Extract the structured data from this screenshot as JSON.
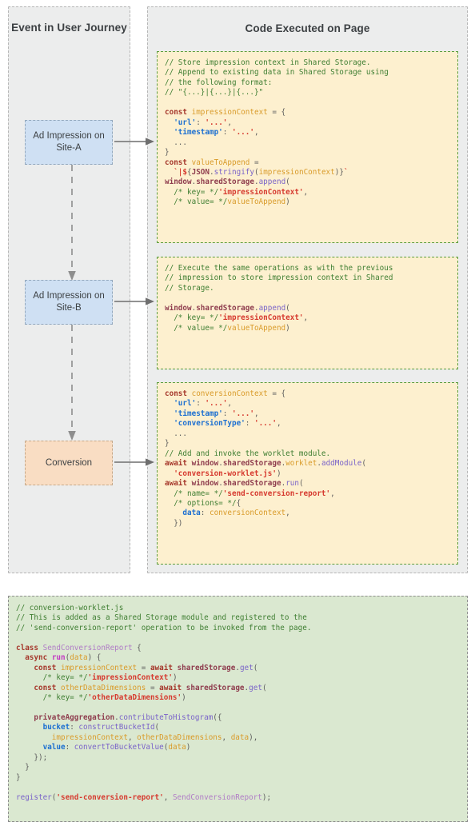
{
  "diagram": {
    "title_journey": "Event in User Journey",
    "title_code": "Code Executed on Page",
    "nodes": [
      {
        "id": "ad-impression-site-a",
        "label": "Ad Impression on Site-A",
        "color": "#cfe0f3"
      },
      {
        "id": "ad-impression-site-b",
        "label": "Ad Impression on Site-B",
        "color": "#cfe0f3"
      },
      {
        "id": "conversion",
        "label": "Conversion",
        "color": "#f9ddc3"
      }
    ],
    "colors": {
      "panel_bg": "#eceded",
      "panel_border": "#b6b6b6",
      "code_yellow_bg": "#fdf0cf",
      "code_yellow_border": "#5d9d3e",
      "code_green_bg": "#dae8d0",
      "code_green_border": "#8f8f8f",
      "comment": "#3f7e32",
      "keyword": "#a5372b",
      "string": "#d63a2f",
      "variable": "#d99b2a",
      "property": "#1c6fd1",
      "function": "#7a63c9"
    }
  },
  "code_blocks": {
    "impression_a": [
      [
        [
          "com",
          "// Store impression context in Shared Storage."
        ]
      ],
      [
        [
          "com",
          "// Append to existing data in Shared Storage using"
        ]
      ],
      [
        [
          "com",
          "// the following format:"
        ]
      ],
      [
        [
          "com",
          "// \"{...}|{...}|{...}\""
        ]
      ],
      [],
      [
        [
          "kw",
          "const"
        ],
        [
          "plain",
          " "
        ],
        [
          "var",
          "impressionContext"
        ],
        [
          "pun",
          " = {"
        ]
      ],
      [
        [
          "pun",
          "  "
        ],
        [
          "prop",
          "'url'"
        ],
        [
          "pun",
          ": "
        ],
        [
          "str",
          "'...'"
        ],
        [
          "pun",
          ","
        ]
      ],
      [
        [
          "pun",
          "  "
        ],
        [
          "prop",
          "'timestamp'"
        ],
        [
          "pun",
          ": "
        ],
        [
          "str",
          "'...'"
        ],
        [
          "pun",
          ","
        ]
      ],
      [
        [
          "pun",
          "  ..."
        ]
      ],
      [
        [
          "pun",
          "}"
        ]
      ],
      [
        [
          "kw",
          "const"
        ],
        [
          "plain",
          " "
        ],
        [
          "var",
          "valueToAppend"
        ],
        [
          "pun",
          " ="
        ]
      ],
      [
        [
          "pun",
          "  "
        ],
        [
          "str",
          "`|$"
        ],
        [
          "pun",
          "{"
        ],
        [
          "obj",
          "JSON"
        ],
        [
          "pun",
          "."
        ],
        [
          "fn",
          "stringify"
        ],
        [
          "pun",
          "("
        ],
        [
          "var",
          "impressionContext"
        ],
        [
          "pun",
          ")}"
        ],
        [
          "str",
          "`"
        ]
      ],
      [
        [
          "obj",
          "window"
        ],
        [
          "pun",
          "."
        ],
        [
          "obj",
          "sharedStorage"
        ],
        [
          "pun",
          "."
        ],
        [
          "fn",
          "append"
        ],
        [
          "pun",
          "("
        ]
      ],
      [
        [
          "pun",
          "  "
        ],
        [
          "com",
          "/* key= */"
        ],
        [
          "str",
          "'impressionContext'"
        ],
        [
          "pun",
          ","
        ]
      ],
      [
        [
          "pun",
          "  "
        ],
        [
          "com",
          "/* value= */"
        ],
        [
          "var",
          "valueToAppend"
        ],
        [
          "pun",
          ")"
        ]
      ]
    ],
    "impression_b": [
      [
        [
          "com",
          "// Execute the same operations as with the previous"
        ]
      ],
      [
        [
          "com",
          "// impression to store impression context in Shared"
        ]
      ],
      [
        [
          "com",
          "// Storage."
        ]
      ],
      [],
      [
        [
          "obj",
          "window"
        ],
        [
          "pun",
          "."
        ],
        [
          "obj",
          "sharedStorage"
        ],
        [
          "pun",
          "."
        ],
        [
          "fn",
          "append"
        ],
        [
          "pun",
          "("
        ]
      ],
      [
        [
          "pun",
          "  "
        ],
        [
          "com",
          "/* key= */"
        ],
        [
          "str",
          "'impressionContext'"
        ],
        [
          "pun",
          ","
        ]
      ],
      [
        [
          "pun",
          "  "
        ],
        [
          "com",
          "/* value= */"
        ],
        [
          "var",
          "valueToAppend"
        ],
        [
          "pun",
          ")"
        ]
      ]
    ],
    "conversion": [
      [
        [
          "kw",
          "const"
        ],
        [
          "plain",
          " "
        ],
        [
          "var",
          "conversionContext"
        ],
        [
          "pun",
          " = {"
        ]
      ],
      [
        [
          "pun",
          "  "
        ],
        [
          "prop",
          "'url'"
        ],
        [
          "pun",
          ": "
        ],
        [
          "str",
          "'...'"
        ],
        [
          "pun",
          ","
        ]
      ],
      [
        [
          "pun",
          "  "
        ],
        [
          "prop",
          "'timestamp'"
        ],
        [
          "pun",
          ": "
        ],
        [
          "str",
          "'...'"
        ],
        [
          "pun",
          ","
        ]
      ],
      [
        [
          "pun",
          "  "
        ],
        [
          "prop",
          "'conversionType'"
        ],
        [
          "pun",
          ": "
        ],
        [
          "str",
          "'...'"
        ],
        [
          "pun",
          ","
        ]
      ],
      [
        [
          "pun",
          "  ..."
        ]
      ],
      [
        [
          "pun",
          "}"
        ]
      ],
      [
        [
          "com",
          "// Add and invoke the worklet module."
        ]
      ],
      [
        [
          "kw",
          "await"
        ],
        [
          "plain",
          " "
        ],
        [
          "obj",
          "window"
        ],
        [
          "pun",
          "."
        ],
        [
          "obj",
          "sharedStorage"
        ],
        [
          "pun",
          "."
        ],
        [
          "var",
          "worklet"
        ],
        [
          "pun",
          "."
        ],
        [
          "fn",
          "addModule"
        ],
        [
          "pun",
          "("
        ]
      ],
      [
        [
          "pun",
          "  "
        ],
        [
          "str",
          "'conversion-worklet.js'"
        ],
        [
          "pun",
          ")"
        ]
      ],
      [
        [
          "kw",
          "await"
        ],
        [
          "plain",
          " "
        ],
        [
          "obj",
          "window"
        ],
        [
          "pun",
          "."
        ],
        [
          "obj",
          "sharedStorage"
        ],
        [
          "pun",
          "."
        ],
        [
          "fn",
          "run"
        ],
        [
          "pun",
          "("
        ]
      ],
      [
        [
          "pun",
          "  "
        ],
        [
          "com",
          "/* name= */"
        ],
        [
          "str",
          "'send-conversion-report'"
        ],
        [
          "pun",
          ","
        ]
      ],
      [
        [
          "pun",
          "  "
        ],
        [
          "com",
          "/* options= */"
        ],
        [
          "pun",
          "{"
        ]
      ],
      [
        [
          "pun",
          "    "
        ],
        [
          "prop",
          "data"
        ],
        [
          "pun",
          ": "
        ],
        [
          "var",
          "conversionContext"
        ],
        [
          "pun",
          ","
        ]
      ],
      [
        [
          "pun",
          "  })"
        ]
      ]
    ],
    "worklet": [
      [
        [
          "com",
          "// conversion-worklet.js"
        ]
      ],
      [
        [
          "com",
          "// This is added as a Shared Storage module and registered to the"
        ]
      ],
      [
        [
          "com",
          "// 'send-conversion-report' operation to be invoked from the page."
        ]
      ],
      [],
      [
        [
          "kw",
          "class"
        ],
        [
          "plain",
          " "
        ],
        [
          "cls",
          "SendConversionReport"
        ],
        [
          "pun",
          " {"
        ]
      ],
      [
        [
          "pun",
          "  "
        ],
        [
          "kw",
          "async"
        ],
        [
          "plain",
          " "
        ],
        [
          "run",
          "run"
        ],
        [
          "pun",
          "("
        ],
        [
          "var",
          "data"
        ],
        [
          "pun",
          ") {"
        ]
      ],
      [
        [
          "pun",
          "    "
        ],
        [
          "kw",
          "const"
        ],
        [
          "plain",
          " "
        ],
        [
          "var",
          "impressionContext"
        ],
        [
          "pun",
          " = "
        ],
        [
          "kw",
          "await"
        ],
        [
          "plain",
          " "
        ],
        [
          "obj",
          "sharedStorage"
        ],
        [
          "pun",
          "."
        ],
        [
          "fn",
          "get"
        ],
        [
          "pun",
          "("
        ]
      ],
      [
        [
          "pun",
          "      "
        ],
        [
          "com",
          "/* key= */"
        ],
        [
          "str",
          "'impressionContext'"
        ],
        [
          "pun",
          ")"
        ]
      ],
      [
        [
          "pun",
          "    "
        ],
        [
          "kw",
          "const"
        ],
        [
          "plain",
          " "
        ],
        [
          "var",
          "otherDataDimensions"
        ],
        [
          "pun",
          " = "
        ],
        [
          "kw",
          "await"
        ],
        [
          "plain",
          " "
        ],
        [
          "obj",
          "sharedStorage"
        ],
        [
          "pun",
          "."
        ],
        [
          "fn",
          "get"
        ],
        [
          "pun",
          "("
        ]
      ],
      [
        [
          "pun",
          "      "
        ],
        [
          "com",
          "/* key= */"
        ],
        [
          "str",
          "'otherDataDimensions'"
        ],
        [
          "pun",
          ")"
        ]
      ],
      [],
      [
        [
          "pun",
          "    "
        ],
        [
          "obj",
          "privateAggregation"
        ],
        [
          "pun",
          "."
        ],
        [
          "fn",
          "contributeToHistogram"
        ],
        [
          "pun",
          "({"
        ]
      ],
      [
        [
          "pun",
          "      "
        ],
        [
          "prop",
          "bucket"
        ],
        [
          "pun",
          ": "
        ],
        [
          "fn",
          "constructBucketId"
        ],
        [
          "pun",
          "("
        ]
      ],
      [
        [
          "pun",
          "        "
        ],
        [
          "var",
          "impressionContext"
        ],
        [
          "pun",
          ", "
        ],
        [
          "var",
          "otherDataDimensions"
        ],
        [
          "pun",
          ", "
        ],
        [
          "var",
          "data"
        ],
        [
          "pun",
          "),"
        ]
      ],
      [
        [
          "pun",
          "      "
        ],
        [
          "prop",
          "value"
        ],
        [
          "pun",
          ": "
        ],
        [
          "fn",
          "convertToBucketValue"
        ],
        [
          "pun",
          "("
        ],
        [
          "var",
          "data"
        ],
        [
          "pun",
          ")"
        ]
      ],
      [
        [
          "pun",
          "    });"
        ]
      ],
      [
        [
          "pun",
          "  }"
        ]
      ],
      [
        [
          "pun",
          "}"
        ]
      ],
      [],
      [
        [
          "fn",
          "register"
        ],
        [
          "pun",
          "("
        ],
        [
          "str",
          "'send-conversion-report'"
        ],
        [
          "pun",
          ", "
        ],
        [
          "cls",
          "SendConversionReport"
        ],
        [
          "pun",
          ");"
        ]
      ]
    ]
  }
}
